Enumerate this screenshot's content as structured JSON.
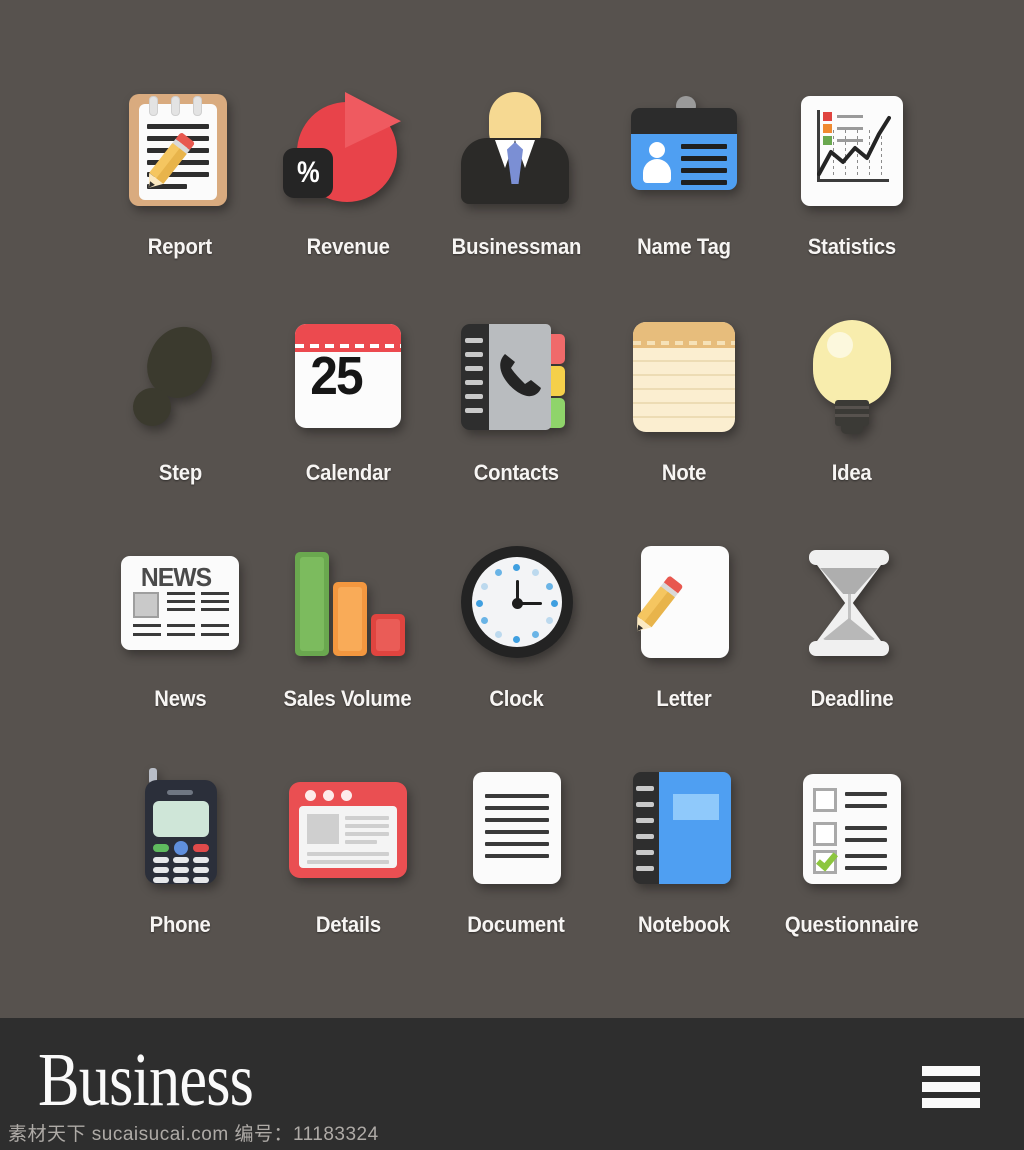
{
  "page": {
    "background_color": "#57524e",
    "footer_background": "#2e2e2e"
  },
  "icons": [
    {
      "id": "report",
      "label": "Report",
      "icon_name": "report-notepad-icon",
      "colors": [
        "#d9ab7f",
        "#fbfbfb",
        "#f5c660"
      ]
    },
    {
      "id": "revenue",
      "label": "Revenue",
      "icon_name": "revenue-pie-chart-icon",
      "badge": "%",
      "colors": [
        "#e8434a",
        "#ef5a60",
        "#252525"
      ]
    },
    {
      "id": "businessman",
      "label": "Businessman",
      "icon_name": "businessman-icon",
      "colors": [
        "#2b2a28",
        "#f6d992",
        "#7b8fd4"
      ]
    },
    {
      "id": "nametag",
      "label": "Name Tag",
      "icon_name": "name-tag-badge-icon",
      "colors": [
        "#2c2c2c",
        "#4f9ff2",
        "#9a9a9a"
      ]
    },
    {
      "id": "statistics",
      "label": "Statistics",
      "icon_name": "statistics-chart-icon",
      "colors": [
        "#fcfcfc",
        "#e0443f",
        "#f08a30",
        "#6aa84f"
      ]
    },
    {
      "id": "step",
      "label": "Step",
      "icon_name": "footprint-step-icon",
      "colors": [
        "#3b3a2e"
      ]
    },
    {
      "id": "calendar",
      "label": "Calendar",
      "icon_name": "calendar-icon",
      "day": "25",
      "colors": [
        "#ec4a4f",
        "#fcfcfc"
      ]
    },
    {
      "id": "contacts",
      "label": "Contacts",
      "icon_name": "contacts-book-icon",
      "colors": [
        "#2e2e2e",
        "#b9bcbf",
        "#f06a6a",
        "#f5d04a",
        "#8fd46a"
      ]
    },
    {
      "id": "note",
      "label": "Note",
      "icon_name": "note-pad-icon",
      "colors": [
        "#e7bd7c",
        "#fbeed0"
      ]
    },
    {
      "id": "idea",
      "label": "Idea",
      "icon_name": "lightbulb-idea-icon",
      "colors": [
        "#f8edad",
        "#3b3a36"
      ]
    },
    {
      "id": "news",
      "label": "News",
      "icon_name": "newspaper-icon",
      "headline": "NEWS",
      "colors": [
        "#fbfbfb",
        "#4a4a4a"
      ]
    },
    {
      "id": "sales-volume",
      "label": "Sales Volume",
      "icon_name": "bar-chart-icon",
      "colors": [
        "#6aa84f",
        "#f3973f",
        "#e0443f"
      ]
    },
    {
      "id": "clock",
      "label": "Clock",
      "icon_name": "clock-icon",
      "colors": [
        "#232323",
        "#f3f4f6",
        "#3f9fe0"
      ]
    },
    {
      "id": "letter",
      "label": "Letter",
      "icon_name": "letter-pencil-icon",
      "colors": [
        "#fcfcfc",
        "#f5c660",
        "#e8584f"
      ]
    },
    {
      "id": "deadline",
      "label": "Deadline",
      "icon_name": "hourglass-deadline-icon",
      "colors": [
        "#f0f0f0",
        "#aeaeae"
      ]
    },
    {
      "id": "phone",
      "label": "Phone",
      "icon_name": "mobile-phone-icon",
      "colors": [
        "#2b2f3a",
        "#cfe6d8",
        "#5fbb5f",
        "#e04a4a",
        "#5f8fdd"
      ]
    },
    {
      "id": "details",
      "label": "Details",
      "icon_name": "browser-window-details-icon",
      "colors": [
        "#ea4f52",
        "#f4f4f4",
        "#cfcfcf"
      ]
    },
    {
      "id": "document",
      "label": "Document",
      "icon_name": "document-page-icon",
      "colors": [
        "#fbfbfb",
        "#3a3a3a"
      ]
    },
    {
      "id": "notebook",
      "label": "Notebook",
      "icon_name": "notebook-icon",
      "colors": [
        "#2e2e2e",
        "#4f9ff2",
        "#8fc9fb"
      ]
    },
    {
      "id": "questionnaire",
      "label": "Questionnaire",
      "icon_name": "questionnaire-checklist-icon",
      "colors": [
        "#fbfbfb",
        "#8cc63e",
        "#a9a9a9"
      ]
    }
  ],
  "footer": {
    "title": "Business",
    "menu_icon": "hamburger-menu-icon"
  },
  "watermark": {
    "text": "素材天下 sucaisucai.com 编号：11183324"
  }
}
